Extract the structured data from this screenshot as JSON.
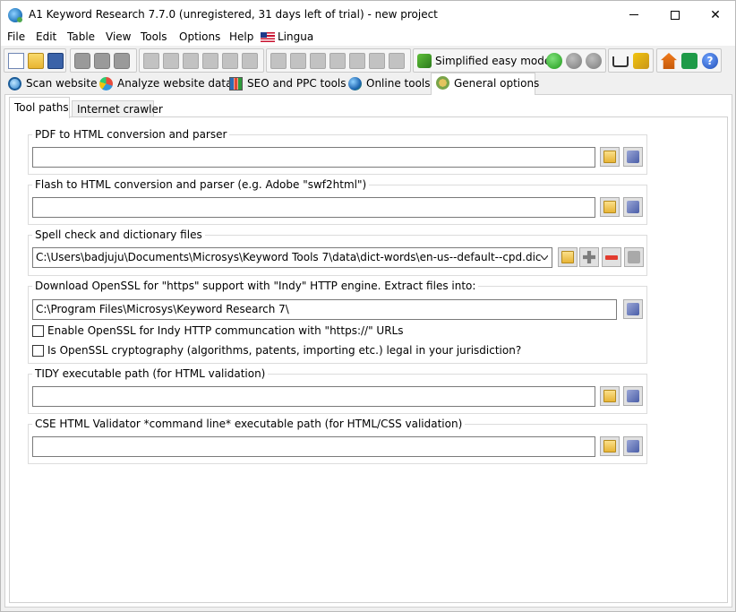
{
  "window": {
    "title": "A1 Keyword Research 7.7.0 (unregistered, 31 days left of trial) - new project",
    "close_glyph": "✕"
  },
  "menu": {
    "file": "File",
    "edit": "Edit",
    "table": "Table",
    "view": "View",
    "tools": "Tools",
    "options": "Options",
    "help": "Help",
    "lingua": "Lingua"
  },
  "toolbar": {
    "mode_label": "Simplified easy mode",
    "help_glyph": "?"
  },
  "main_tabs": {
    "scan": "Scan website",
    "analyze": "Analyze website data",
    "seo": "SEO and PPC tools",
    "online": "Online tools",
    "general": "General options"
  },
  "sub_tabs": {
    "tool_paths": "Tool paths",
    "crawler": "Internet crawler"
  },
  "groups": {
    "pdf": {
      "label": "PDF to HTML conversion and parser",
      "value": ""
    },
    "flash": {
      "label": "Flash to HTML conversion and parser (e.g. Adobe \"swf2html\")",
      "value": ""
    },
    "spell": {
      "label": "Spell check and dictionary files",
      "value": "C:\\Users\\badjuju\\Documents\\Microsys\\Keyword Tools 7\\data\\dict-words\\en-us--default--cpd.dic"
    },
    "openssl": {
      "label": "Download OpenSSL for \"https\" support with \"Indy\" HTTP engine. Extract files into:",
      "value": "C:\\Program Files\\Microsys\\Keyword Research 7\\",
      "enable_label": "Enable OpenSSL for Indy HTTP communcation with \"https://\" URLs",
      "legal_label": "Is OpenSSL cryptography (algorithms, patents, importing etc.) legal in your jurisdiction?"
    },
    "tidy": {
      "label": "TIDY executable path (for HTML validation)",
      "value": ""
    },
    "cse": {
      "label": "CSE HTML Validator *command line* executable path (for HTML/CSS validation)",
      "value": ""
    }
  }
}
